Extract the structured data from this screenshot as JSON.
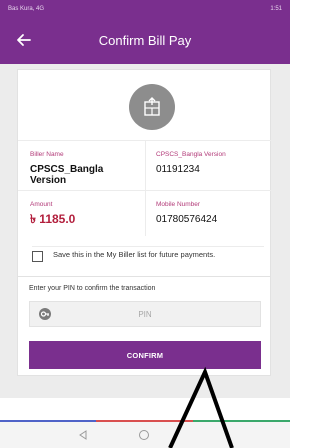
{
  "status_bar": {
    "carrier": "Bas Kura, 4G",
    "time": "1:51"
  },
  "app_bar": {
    "title": "Confirm Bill Pay",
    "back_icon": "arrow-left-icon"
  },
  "biller_card": {
    "icon": "bill-document-icon",
    "fields": [
      {
        "label": "Biller Name",
        "value": "CPSCS_Bangla Version"
      },
      {
        "label": "CPSCS_Bangla Version",
        "value": "01191234"
      },
      {
        "label": "Amount",
        "value": "৳ 1185.0"
      },
      {
        "label": "Mobile Number",
        "value": "01780576424"
      }
    ],
    "save_option": {
      "label": "Save this in the My Biller list for future payments.",
      "checked": false
    }
  },
  "pin_section": {
    "label": "Enter your PIN to confirm the transaction",
    "placeholder": "PIN",
    "icon": "key-icon",
    "confirm_label": "CONFIRM"
  },
  "nav_bar": {
    "back_icon": "nav-back-icon",
    "home_icon": "nav-home-icon"
  },
  "colors": {
    "primary": "#7a2f8e",
    "label_accent": "#b23a78",
    "amount": "#b21e3c",
    "nav_lines": [
      "#4f63c8",
      "#d94f4f",
      "#3aa86b"
    ]
  }
}
